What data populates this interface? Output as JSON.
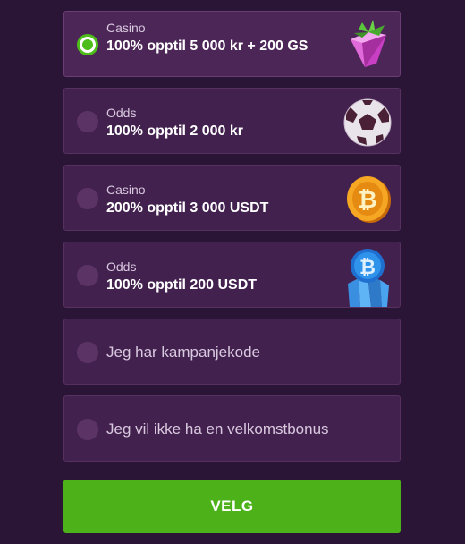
{
  "options": [
    {
      "category": "Casino",
      "title": "100% opptil 5 000 kr + 200 GS",
      "selected": true,
      "icon": "gem-icon"
    },
    {
      "category": "Odds",
      "title": "100% opptil 2 000 kr",
      "selected": false,
      "icon": "football-icon"
    },
    {
      "category": "Casino",
      "title": "200% opptil 3 000 USDT",
      "selected": false,
      "icon": "bitcoin-coin-icon"
    },
    {
      "category": "Odds",
      "title": "100% opptil 200 USDT",
      "selected": false,
      "icon": "bitcoin-crystal-icon"
    },
    {
      "label": "Jeg har kampanjekode",
      "selected": false
    },
    {
      "label": "Jeg vil ikke ha en velkomstbonus",
      "selected": false
    }
  ],
  "button": {
    "label": "VELG"
  },
  "colors": {
    "background": "#2a1536",
    "option": "#43214f",
    "accent_green": "#4db21a"
  }
}
